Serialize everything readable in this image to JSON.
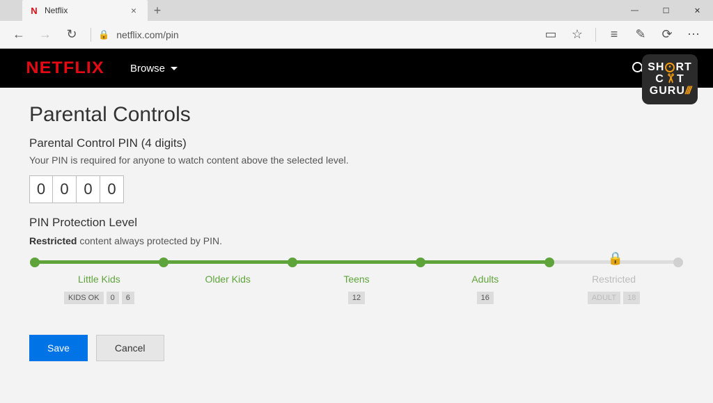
{
  "browser": {
    "tab_icon_letter": "N",
    "tab_title": "Netflix",
    "url": "netflix.com/pin"
  },
  "watermark": {
    "line1_left": "SH",
    "line1_right": "RT",
    "line2_left": "C",
    "line2_right": "T",
    "line3": "GURU",
    "line3_suffix": "///"
  },
  "nf": {
    "logo": "NETFLIX",
    "browse": "Browse",
    "search": "Search"
  },
  "page": {
    "title": "Parental Controls",
    "pin_title": "Parental Control PIN (4 digits)",
    "pin_desc": "Your PIN is required for anyone to watch content above the selected level.",
    "pin_digits": [
      "0",
      "0",
      "0",
      "0"
    ],
    "level_title": "PIN Protection Level",
    "level_desc_bold": "Restricted",
    "level_desc_rest": " content always protected by PIN.",
    "save": "Save",
    "cancel": "Cancel"
  },
  "slider": {
    "levels": [
      {
        "name": "Little Kids",
        "badges": [
          "KIDS OK",
          "0",
          "6"
        ],
        "dim": false
      },
      {
        "name": "Older Kids",
        "badges": [],
        "dim": false
      },
      {
        "name": "Teens",
        "badges": [
          "12"
        ],
        "dim": false
      },
      {
        "name": "Adults",
        "badges": [
          "16"
        ],
        "dim": false
      },
      {
        "name": "Restricted",
        "badges": [
          "ADULT",
          "18"
        ],
        "dim": true
      }
    ]
  }
}
